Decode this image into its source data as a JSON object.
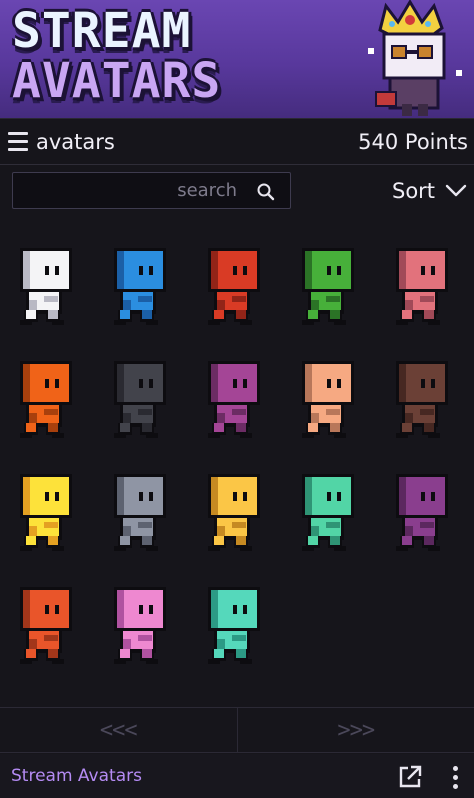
{
  "banner": {
    "logo_line1": "STREAM",
    "logo_line2": "AVATARS"
  },
  "header": {
    "menu_icon": "hamburger-icon",
    "page_label": "avatars",
    "points_label": "540 Points"
  },
  "search": {
    "placeholder": "search",
    "value": "",
    "icon": "search-icon"
  },
  "sort": {
    "label": "Sort",
    "icon": "chevron-down-icon"
  },
  "avatars": [
    {
      "color": "#f4f4f6",
      "shade": "#b9b9c4"
    },
    {
      "color": "#2b8ee0",
      "shade": "#1b5fa6"
    },
    {
      "color": "#d93b25",
      "shade": "#922418"
    },
    {
      "color": "#47b03a",
      "shade": "#2b7326"
    },
    {
      "color": "#e2727c",
      "shade": "#a14a58"
    },
    {
      "color": "#f06318",
      "shade": "#a8400d"
    },
    {
      "color": "#42434b",
      "shade": "#2a2a31"
    },
    {
      "color": "#a44596",
      "shade": "#6c2c64"
    },
    {
      "color": "#f6a982",
      "shade": "#b8775a"
    },
    {
      "color": "#6b4036",
      "shade": "#472822"
    },
    {
      "color": "#fde23a",
      "shade": "#e4a122"
    },
    {
      "color": "#8f95a4",
      "shade": "#5d6270"
    },
    {
      "color": "#fbc646",
      "shade": "#c68a22"
    },
    {
      "color": "#52d5a6",
      "shade": "#2f9475"
    },
    {
      "color": "#8a3e8e",
      "shade": "#5c285f"
    },
    {
      "color": "#e9552a",
      "shade": "#a2361a"
    },
    {
      "color": "#ee88d0",
      "shade": "#b052a0"
    },
    {
      "color": "#55d8bb",
      "shade": "#2c9a85"
    }
  ],
  "pager": {
    "prev_label": "<<<",
    "next_label": ">>>"
  },
  "footer": {
    "title": "Stream Avatars",
    "popout_icon": "popout-icon",
    "more_icon": "kebab-menu-icon"
  }
}
